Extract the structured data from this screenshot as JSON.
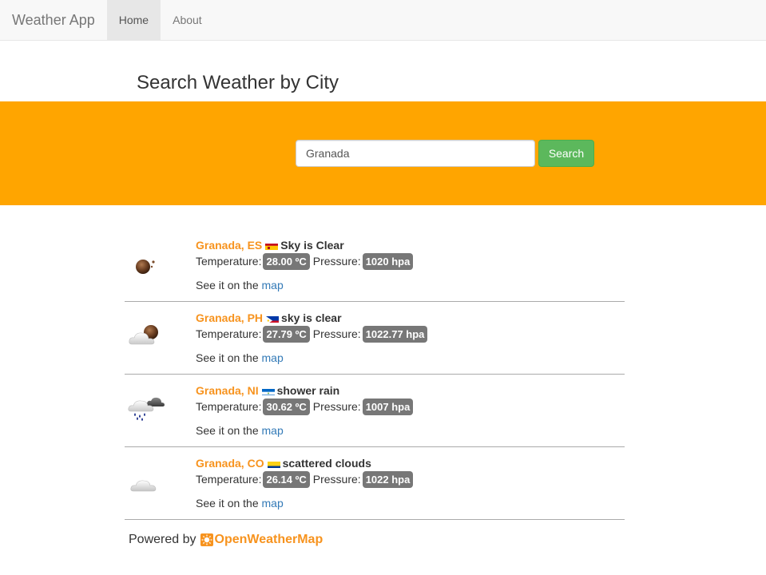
{
  "navbar": {
    "brand": "Weather App",
    "links": [
      {
        "label": "Home",
        "active": true
      },
      {
        "label": "About",
        "active": false
      }
    ]
  },
  "page": {
    "title": "Search Weather by City"
  },
  "search": {
    "value": "Granada",
    "button_label": "Search",
    "band_color": "#ffa500",
    "button_color": "#5cb85c"
  },
  "results": [
    {
      "city": "Granada, ES",
      "flag": "spain-flag-icon",
      "description": "Sky is Clear",
      "temp_label": "Temperature:",
      "temperature": "28.00 ºC",
      "pressure_label": "Pressure:",
      "pressure": "1020 hpa",
      "map_prefix": "See it on the",
      "map_link": "map",
      "icon": "clear-night-moon-icon"
    },
    {
      "city": "Granada, PH",
      "flag": "philippines-flag-icon",
      "description": "sky is clear",
      "temp_label": "Temperature:",
      "temperature": "27.79 ºC",
      "pressure_label": "Pressure:",
      "pressure": "1022.77 hpa",
      "map_prefix": "See it on the",
      "map_link": "map",
      "icon": "moon-behind-cloud-icon"
    },
    {
      "city": "Granada, NI",
      "flag": "nicaragua-flag-icon",
      "description": "shower rain",
      "temp_label": "Temperature:",
      "temperature": "30.62 ºC",
      "pressure_label": "Pressure:",
      "pressure": "1007 hpa",
      "map_prefix": "See it on the",
      "map_link": "map",
      "icon": "shower-rain-cloud-icon"
    },
    {
      "city": "Granada, CO",
      "flag": "colombia-flag-icon",
      "description": "scattered clouds",
      "temp_label": "Temperature:",
      "temperature": "26.14 ºC",
      "pressure_label": "Pressure:",
      "pressure": "1022 hpa",
      "map_prefix": "See it on the",
      "map_link": "map",
      "icon": "scattered-clouds-icon"
    }
  ],
  "footer": {
    "powered_by": "Powered by",
    "provider": "OpenWeatherMap"
  },
  "colors": {
    "city": "#f7931e",
    "badge": "#777777",
    "link": "#337ab7"
  }
}
